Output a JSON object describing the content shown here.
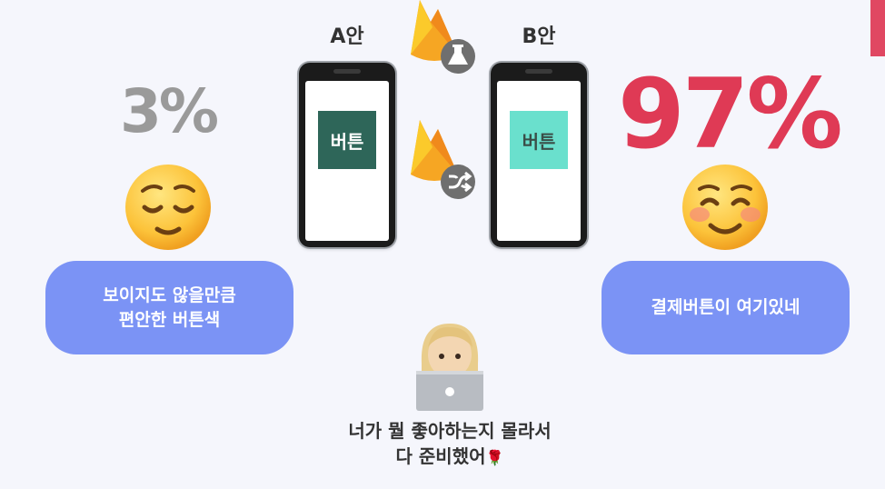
{
  "version_a": {
    "label": "A안",
    "percent": "3%",
    "button_label": "버튼",
    "button_color": "#2e6659",
    "comment": [
      "보이지도 않을만큼",
      "편안한 버튼색"
    ]
  },
  "version_b": {
    "label": "B안",
    "percent": "97%",
    "button_label": "버튼",
    "button_color": "#6ae0cd",
    "comment": [
      "결제버튼이 여기있네"
    ]
  },
  "caption": [
    "너가 뭘 좋아하는지 몰라서",
    "다 준비했어"
  ],
  "colors": {
    "accent": "#df3a55",
    "bubble": "#7b93f5",
    "firebase_orange": "#f6a623",
    "firebase_yellow": "#fbca2b"
  },
  "icons": [
    "relieved-face-icon",
    "smiling-face-icon",
    "firebase-ab-testing-icon",
    "firebase-remote-config-icon",
    "developer-laptop-icon",
    "rose-icon"
  ]
}
